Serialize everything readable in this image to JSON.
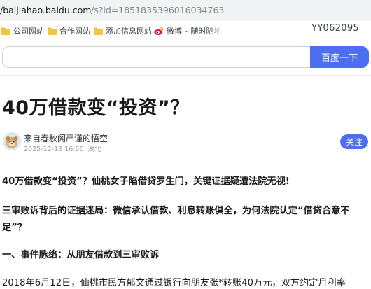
{
  "browser": {
    "url_host": "/baijiahao.baidu.com",
    "url_path": "/s?id=1851835396016034763"
  },
  "bookmarks": [
    {
      "label": "公司网站",
      "icon": "folder-icon"
    },
    {
      "label": "合作网站",
      "icon": "folder-icon"
    },
    {
      "label": "添加信息网站",
      "icon": "folder-icon"
    },
    {
      "label": "微博 – 随时随地",
      "icon": "weibo-icon"
    }
  ],
  "user_id": "YY062095",
  "search": {
    "value": "",
    "placeholder": "",
    "button_label": "百度一下"
  },
  "article": {
    "title": "40万借款变“投资”？",
    "author": "来自春秋阁严谨的悟空",
    "date": "2025-12-18 16:50",
    "location": "湖北",
    "follow_label": "关注",
    "paragraphs": [
      "40万借款变“投资”？仙桃女子陷借贷罗生门，关键证据疑遭法院无视!",
      "三审败诉背后的证据迷局：微信承认借款、利息转账俱全，为何法院认定“借贷合意不足”？",
      "一、事件脉络：从朋友借款到三审败诉",
      "2018年6月12日，仙桃市民方郁文通过银行向朋友张*转账40万元，双方约定月利率"
    ]
  },
  "colors": {
    "accent": "#4e6ef2",
    "folder": "#f2b731"
  }
}
